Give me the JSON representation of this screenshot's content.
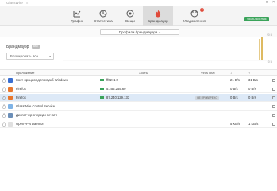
{
  "titlebar": {
    "app_name": "GlassWire",
    "menu": "≡",
    "controls": [
      "─",
      "□",
      "×"
    ]
  },
  "tabs": [
    {
      "label": "График",
      "icon": "graph-icon"
    },
    {
      "label": "Статистика",
      "icon": "statistics-icon"
    },
    {
      "label": "Вещи",
      "icon": "things-icon"
    },
    {
      "label": "Брандмауэр",
      "icon": "firewall-flame-icon",
      "active": true
    },
    {
      "label": "Уведомления",
      "icon": "notifications-icon",
      "badge": "3"
    }
  ],
  "update_button": "ОБНОВЛЕНИЕ",
  "profile": {
    "label": "Профили брандмауэра",
    "caret": "▾"
  },
  "firewall": {
    "title": "Брандмауэр",
    "toggle": "ВКЛ",
    "mode": "Блокировать все...",
    "caret": "▾"
  },
  "graph": {
    "top_label": "20 B",
    "bottom_label": "0 B"
  },
  "table": {
    "headers": [
      "Приложение",
      "Хосты",
      "VirusTotal",
      "↓",
      "↑"
    ],
    "rows": [
      {
        "app": "Хост-процесс для служб Windows",
        "host": "ff02::1:2",
        "down": "21 B/s",
        "up": "31 B/s",
        "icon_color": "#3b6fd1",
        "flag": true
      },
      {
        "app": "Firefox",
        "host": "5.255.255.60",
        "down": "0 B/s",
        "up": "0 B/s",
        "icon_color": "#e8772e",
        "flag": true
      },
      {
        "app": "Firefox",
        "host": "87.240.129.133",
        "vt": "НЕ ПРОВЕРЕНО",
        "down": "0 B/s",
        "up": "0 B/s",
        "icon_color": "#e8772e",
        "flag": true,
        "selected": true
      },
      {
        "app": "GlassWire Control Service",
        "host": "",
        "down": "",
        "up": "",
        "icon_color": "#7fb3e6",
        "flag": false
      },
      {
        "app": "Диспетчер очереди печати",
        "host": "",
        "down": "",
        "up": "",
        "icon_color": "#6c8fb8",
        "flag": false
      },
      {
        "app": "OpenVPN Daemon",
        "host": "",
        "down": "5 KB/s",
        "up": "1 KB/s",
        "icon_color": "#e0e0e0",
        "flag": false
      }
    ]
  },
  "colors": {
    "accent_green": "#3aa35a",
    "flame_red": "#e04a3a",
    "selected_row": "#dde9f7"
  }
}
